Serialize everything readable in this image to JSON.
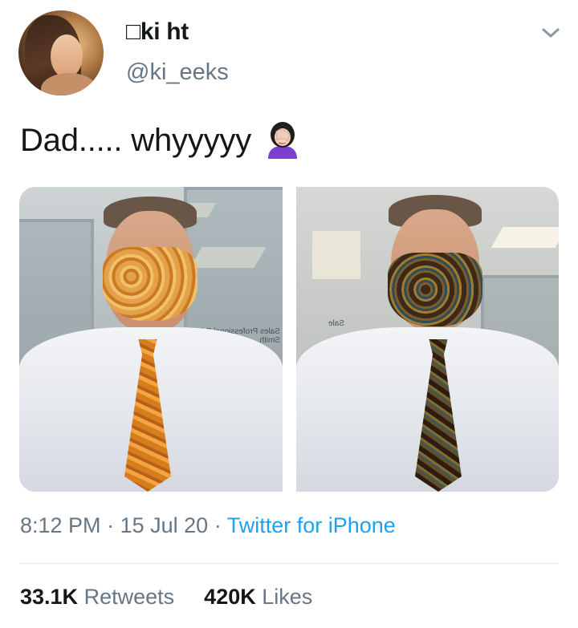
{
  "author": {
    "display_name": "□ki ht",
    "handle": "@ki_eeks",
    "avatar_icon": "profile-photo"
  },
  "menu_icon": "chevron-down-icon",
  "tweet": {
    "text": "Dad..... whyyyyy",
    "emoji": "woman-facepalming"
  },
  "media": {
    "left_sign": "Sales Professional Eric Smith",
    "right_sign": "Sale"
  },
  "meta": {
    "time": "8:12 PM",
    "separator": "·",
    "date": "15 Jul 20",
    "source": "Twitter for iPhone"
  },
  "stats": {
    "retweets_count": "33.1K",
    "retweets_label": "Retweets",
    "likes_count": "420K",
    "likes_label": "Likes"
  },
  "colors": {
    "link": "#1da1f2",
    "secondary_text": "#657786",
    "primary_text": "#14171a"
  }
}
